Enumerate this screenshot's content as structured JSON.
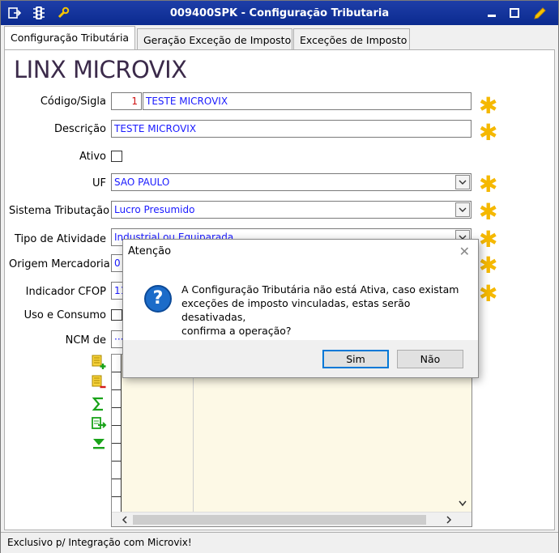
{
  "window": {
    "title": "009400SPK - Configuração Tributaria"
  },
  "tabs": [
    {
      "label": "Configuração Tributária"
    },
    {
      "label": "Geração Exceção de Imposto"
    },
    {
      "label": "Exceções de Imposto"
    }
  ],
  "logo": "LINX MICROVIX",
  "form": {
    "codigo_label": "Código/Sigla",
    "codigo_value": "1",
    "sigla_value": "TESTE MICROVIX",
    "descricao_label": "Descrição",
    "descricao_value": "TESTE MICROVIX",
    "ativo_label": "Ativo",
    "uf_label": "UF",
    "uf_value": "SAO PAULO",
    "sistema_label": "Sistema Tributação",
    "sistema_value": "Lucro Presumido",
    "tipo_label": "Tipo de Atividade",
    "tipo_value": "Industrial ou Equiparada",
    "origem_label": "Origem Mercadoria",
    "origem_value": "0",
    "cfop_label": "Indicador CFOP",
    "cfop_value": "11",
    "uso_label": "Uso e Consumo",
    "ncm_label": "NCM de",
    "ncm_value": "···"
  },
  "statusbar": "Exclusivo p/ Integração com Microvix!",
  "dialog": {
    "title": "Atenção",
    "message_line1": "A Configuração Tributária não está Ativa, caso existam",
    "message_line2": "exceções de imposto vinculadas, estas serão desativadas,",
    "message_line3": "confirma a operação?",
    "yes_label": "Sim",
    "no_label": "Não"
  },
  "colors": {
    "titlebar": "#1e3ea8",
    "field_text": "#1a1aff",
    "required_star": "#f5b800",
    "grid_background": "#fdf9e6"
  }
}
